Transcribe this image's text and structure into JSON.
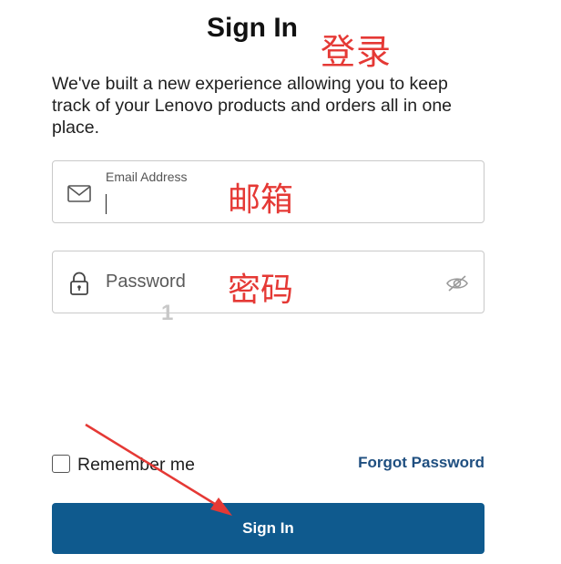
{
  "title": "Sign In",
  "description": "We've built a new experience allowing you to keep track of your Lenovo products and orders all in one place.",
  "email_field": {
    "label": "Email Address",
    "value": ""
  },
  "password_field": {
    "placeholder": "Password",
    "value": ""
  },
  "remember_me": {
    "label": "Remember me",
    "checked": false
  },
  "forgot_password": "Forgot Password",
  "submit_button": "Sign In",
  "annotations": {
    "title_note": "登录",
    "email_note": "邮箱",
    "password_note": "密码",
    "step_number": "1"
  },
  "colors": {
    "primary_button": "#0f5a8e",
    "link": "#1f4f80",
    "annotation": "#e53935"
  },
  "icons": {
    "email": "envelope-icon",
    "password": "lock-icon",
    "visibility": "eye-slash-icon"
  }
}
